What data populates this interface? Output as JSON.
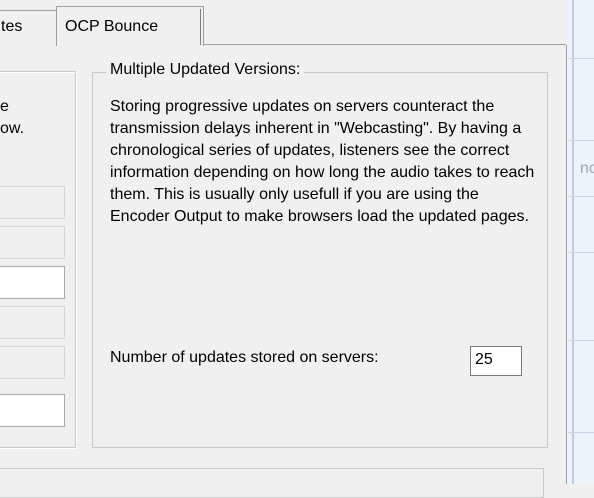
{
  "tabs": [
    {
      "label": "tes"
    },
    {
      "label": "OCP Bounce"
    }
  ],
  "left_panel": {
    "partial_text_line1": "e",
    "partial_text_line2": "ow."
  },
  "multiple_updated_versions": {
    "group_title": "Multiple Updated Versions:",
    "description": "Storing progressive updates on servers counteract the transmission delays inherent in \"Webcasting\". By having a chronological series of updates, listeners see the correct information depending on how long the audio takes to reach them. This is usually only usefull if you are using the Encoder Output to make browsers load the updated pages.",
    "updates_label": "Number of updates stored on servers:",
    "updates_value": "25"
  },
  "right_strip": {
    "ghost_text": "nc"
  }
}
